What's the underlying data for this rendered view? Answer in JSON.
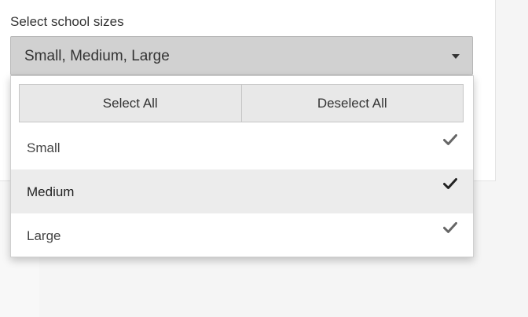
{
  "field": {
    "label": "Select school sizes",
    "selected_value": "Small, Medium, Large"
  },
  "dropdown": {
    "select_all_label": "Select All",
    "deselect_all_label": "Deselect All",
    "options": [
      {
        "label": "Small",
        "checked": true,
        "highlighted": false
      },
      {
        "label": "Medium",
        "checked": true,
        "highlighted": true
      },
      {
        "label": "Large",
        "checked": true,
        "highlighted": false
      }
    ]
  },
  "icons": {
    "caret": "chevron-down-icon",
    "check": "check-icon"
  },
  "colors": {
    "select_bg": "#d1d1d1",
    "action_bar_bg": "#e8e8e8",
    "highlight_bg": "#ececec",
    "check_default": "#666666",
    "check_highlighted": "#222222"
  }
}
